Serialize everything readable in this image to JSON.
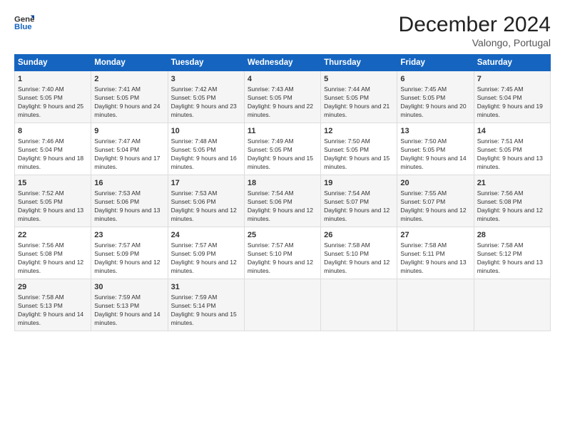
{
  "logo": {
    "line1": "General",
    "line2": "Blue"
  },
  "title": "December 2024",
  "subtitle": "Valongo, Portugal",
  "days_of_week": [
    "Sunday",
    "Monday",
    "Tuesday",
    "Wednesday",
    "Thursday",
    "Friday",
    "Saturday"
  ],
  "weeks": [
    [
      {
        "day": "1",
        "sunrise": "Sunrise: 7:40 AM",
        "sunset": "Sunset: 5:05 PM",
        "daylight": "Daylight: 9 hours and 25 minutes."
      },
      {
        "day": "2",
        "sunrise": "Sunrise: 7:41 AM",
        "sunset": "Sunset: 5:05 PM",
        "daylight": "Daylight: 9 hours and 24 minutes."
      },
      {
        "day": "3",
        "sunrise": "Sunrise: 7:42 AM",
        "sunset": "Sunset: 5:05 PM",
        "daylight": "Daylight: 9 hours and 23 minutes."
      },
      {
        "day": "4",
        "sunrise": "Sunrise: 7:43 AM",
        "sunset": "Sunset: 5:05 PM",
        "daylight": "Daylight: 9 hours and 22 minutes."
      },
      {
        "day": "5",
        "sunrise": "Sunrise: 7:44 AM",
        "sunset": "Sunset: 5:05 PM",
        "daylight": "Daylight: 9 hours and 21 minutes."
      },
      {
        "day": "6",
        "sunrise": "Sunrise: 7:45 AM",
        "sunset": "Sunset: 5:05 PM",
        "daylight": "Daylight: 9 hours and 20 minutes."
      },
      {
        "day": "7",
        "sunrise": "Sunrise: 7:45 AM",
        "sunset": "Sunset: 5:04 PM",
        "daylight": "Daylight: 9 hours and 19 minutes."
      }
    ],
    [
      {
        "day": "8",
        "sunrise": "Sunrise: 7:46 AM",
        "sunset": "Sunset: 5:04 PM",
        "daylight": "Daylight: 9 hours and 18 minutes."
      },
      {
        "day": "9",
        "sunrise": "Sunrise: 7:47 AM",
        "sunset": "Sunset: 5:04 PM",
        "daylight": "Daylight: 9 hours and 17 minutes."
      },
      {
        "day": "10",
        "sunrise": "Sunrise: 7:48 AM",
        "sunset": "Sunset: 5:05 PM",
        "daylight": "Daylight: 9 hours and 16 minutes."
      },
      {
        "day": "11",
        "sunrise": "Sunrise: 7:49 AM",
        "sunset": "Sunset: 5:05 PM",
        "daylight": "Daylight: 9 hours and 15 minutes."
      },
      {
        "day": "12",
        "sunrise": "Sunrise: 7:50 AM",
        "sunset": "Sunset: 5:05 PM",
        "daylight": "Daylight: 9 hours and 15 minutes."
      },
      {
        "day": "13",
        "sunrise": "Sunrise: 7:50 AM",
        "sunset": "Sunset: 5:05 PM",
        "daylight": "Daylight: 9 hours and 14 minutes."
      },
      {
        "day": "14",
        "sunrise": "Sunrise: 7:51 AM",
        "sunset": "Sunset: 5:05 PM",
        "daylight": "Daylight: 9 hours and 13 minutes."
      }
    ],
    [
      {
        "day": "15",
        "sunrise": "Sunrise: 7:52 AM",
        "sunset": "Sunset: 5:05 PM",
        "daylight": "Daylight: 9 hours and 13 minutes."
      },
      {
        "day": "16",
        "sunrise": "Sunrise: 7:53 AM",
        "sunset": "Sunset: 5:06 PM",
        "daylight": "Daylight: 9 hours and 13 minutes."
      },
      {
        "day": "17",
        "sunrise": "Sunrise: 7:53 AM",
        "sunset": "Sunset: 5:06 PM",
        "daylight": "Daylight: 9 hours and 12 minutes."
      },
      {
        "day": "18",
        "sunrise": "Sunrise: 7:54 AM",
        "sunset": "Sunset: 5:06 PM",
        "daylight": "Daylight: 9 hours and 12 minutes."
      },
      {
        "day": "19",
        "sunrise": "Sunrise: 7:54 AM",
        "sunset": "Sunset: 5:07 PM",
        "daylight": "Daylight: 9 hours and 12 minutes."
      },
      {
        "day": "20",
        "sunrise": "Sunrise: 7:55 AM",
        "sunset": "Sunset: 5:07 PM",
        "daylight": "Daylight: 9 hours and 12 minutes."
      },
      {
        "day": "21",
        "sunrise": "Sunrise: 7:56 AM",
        "sunset": "Sunset: 5:08 PM",
        "daylight": "Daylight: 9 hours and 12 minutes."
      }
    ],
    [
      {
        "day": "22",
        "sunrise": "Sunrise: 7:56 AM",
        "sunset": "Sunset: 5:08 PM",
        "daylight": "Daylight: 9 hours and 12 minutes."
      },
      {
        "day": "23",
        "sunrise": "Sunrise: 7:57 AM",
        "sunset": "Sunset: 5:09 PM",
        "daylight": "Daylight: 9 hours and 12 minutes."
      },
      {
        "day": "24",
        "sunrise": "Sunrise: 7:57 AM",
        "sunset": "Sunset: 5:09 PM",
        "daylight": "Daylight: 9 hours and 12 minutes."
      },
      {
        "day": "25",
        "sunrise": "Sunrise: 7:57 AM",
        "sunset": "Sunset: 5:10 PM",
        "daylight": "Daylight: 9 hours and 12 minutes."
      },
      {
        "day": "26",
        "sunrise": "Sunrise: 7:58 AM",
        "sunset": "Sunset: 5:10 PM",
        "daylight": "Daylight: 9 hours and 12 minutes."
      },
      {
        "day": "27",
        "sunrise": "Sunrise: 7:58 AM",
        "sunset": "Sunset: 5:11 PM",
        "daylight": "Daylight: 9 hours and 13 minutes."
      },
      {
        "day": "28",
        "sunrise": "Sunrise: 7:58 AM",
        "sunset": "Sunset: 5:12 PM",
        "daylight": "Daylight: 9 hours and 13 minutes."
      }
    ],
    [
      {
        "day": "29",
        "sunrise": "Sunrise: 7:58 AM",
        "sunset": "Sunset: 5:13 PM",
        "daylight": "Daylight: 9 hours and 14 minutes."
      },
      {
        "day": "30",
        "sunrise": "Sunrise: 7:59 AM",
        "sunset": "Sunset: 5:13 PM",
        "daylight": "Daylight: 9 hours and 14 minutes."
      },
      {
        "day": "31",
        "sunrise": "Sunrise: 7:59 AM",
        "sunset": "Sunset: 5:14 PM",
        "daylight": "Daylight: 9 hours and 15 minutes."
      },
      null,
      null,
      null,
      null
    ]
  ]
}
